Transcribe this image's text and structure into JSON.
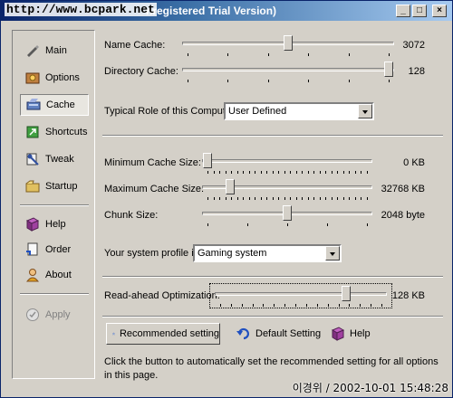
{
  "window": {
    "title": "nregistered Trial Version)",
    "watermark": "http://www.bcpark.net",
    "minimize_glyph": "_",
    "maximize_glyph": "□",
    "close_glyph": "×"
  },
  "sidebar": {
    "items": [
      {
        "label": "Main",
        "icon": "pen-icon",
        "active": false,
        "disabled": false
      },
      {
        "label": "Options",
        "icon": "options-icon",
        "active": false,
        "disabled": false
      },
      {
        "label": "Cache",
        "icon": "cache-icon",
        "active": true,
        "disabled": false
      },
      {
        "label": "Shortcuts",
        "icon": "shortcuts-icon",
        "active": false,
        "disabled": false
      },
      {
        "label": "Tweak",
        "icon": "tweak-icon",
        "active": false,
        "disabled": false
      },
      {
        "label": "Startup",
        "icon": "startup-icon",
        "active": false,
        "disabled": false
      },
      {
        "label": "Help",
        "icon": "help-book-icon",
        "active": false,
        "disabled": false
      },
      {
        "label": "Order",
        "icon": "order-icon",
        "active": false,
        "disabled": false
      },
      {
        "label": "About",
        "icon": "about-icon",
        "active": false,
        "disabled": false
      },
      {
        "label": "Apply",
        "icon": "apply-icon",
        "active": false,
        "disabled": true
      }
    ]
  },
  "main": {
    "name_cache": {
      "label": "Name Cache:",
      "value": "3072",
      "level": 0.5
    },
    "directory_cache": {
      "label": "Directory Cache:",
      "value": "128",
      "level": 1.0
    },
    "typical_role": {
      "label": "Typical Role of this Computer",
      "selected": "User Defined"
    },
    "min_cache": {
      "label": "Minimum Cache Size:",
      "value": "0 KB",
      "level": 0.0
    },
    "max_cache": {
      "label": "Maximum Cache Size:",
      "value": "32768 KB",
      "level": 0.14
    },
    "chunk_size": {
      "label": "Chunk Size:",
      "value": "2048 byte",
      "level": 0.5
    },
    "profile": {
      "label": "Your system profile is",
      "selected": "Gaming system"
    },
    "read_ahead": {
      "label": "Read-ahead Optimization:",
      "value": "128 KB",
      "level": 0.78
    },
    "buttons": {
      "recommended": "Recommended setting",
      "default": "Default Setting",
      "help": "Help"
    },
    "description": "Click the button to automatically set the recommended setting for all options in this page."
  },
  "footer": {
    "stamp": "이경위 / 2002-10-01 15:48:28"
  },
  "colors": {
    "face": "#d4d0c8",
    "title_start": "#0a246a",
    "title_end": "#a6caf0"
  }
}
